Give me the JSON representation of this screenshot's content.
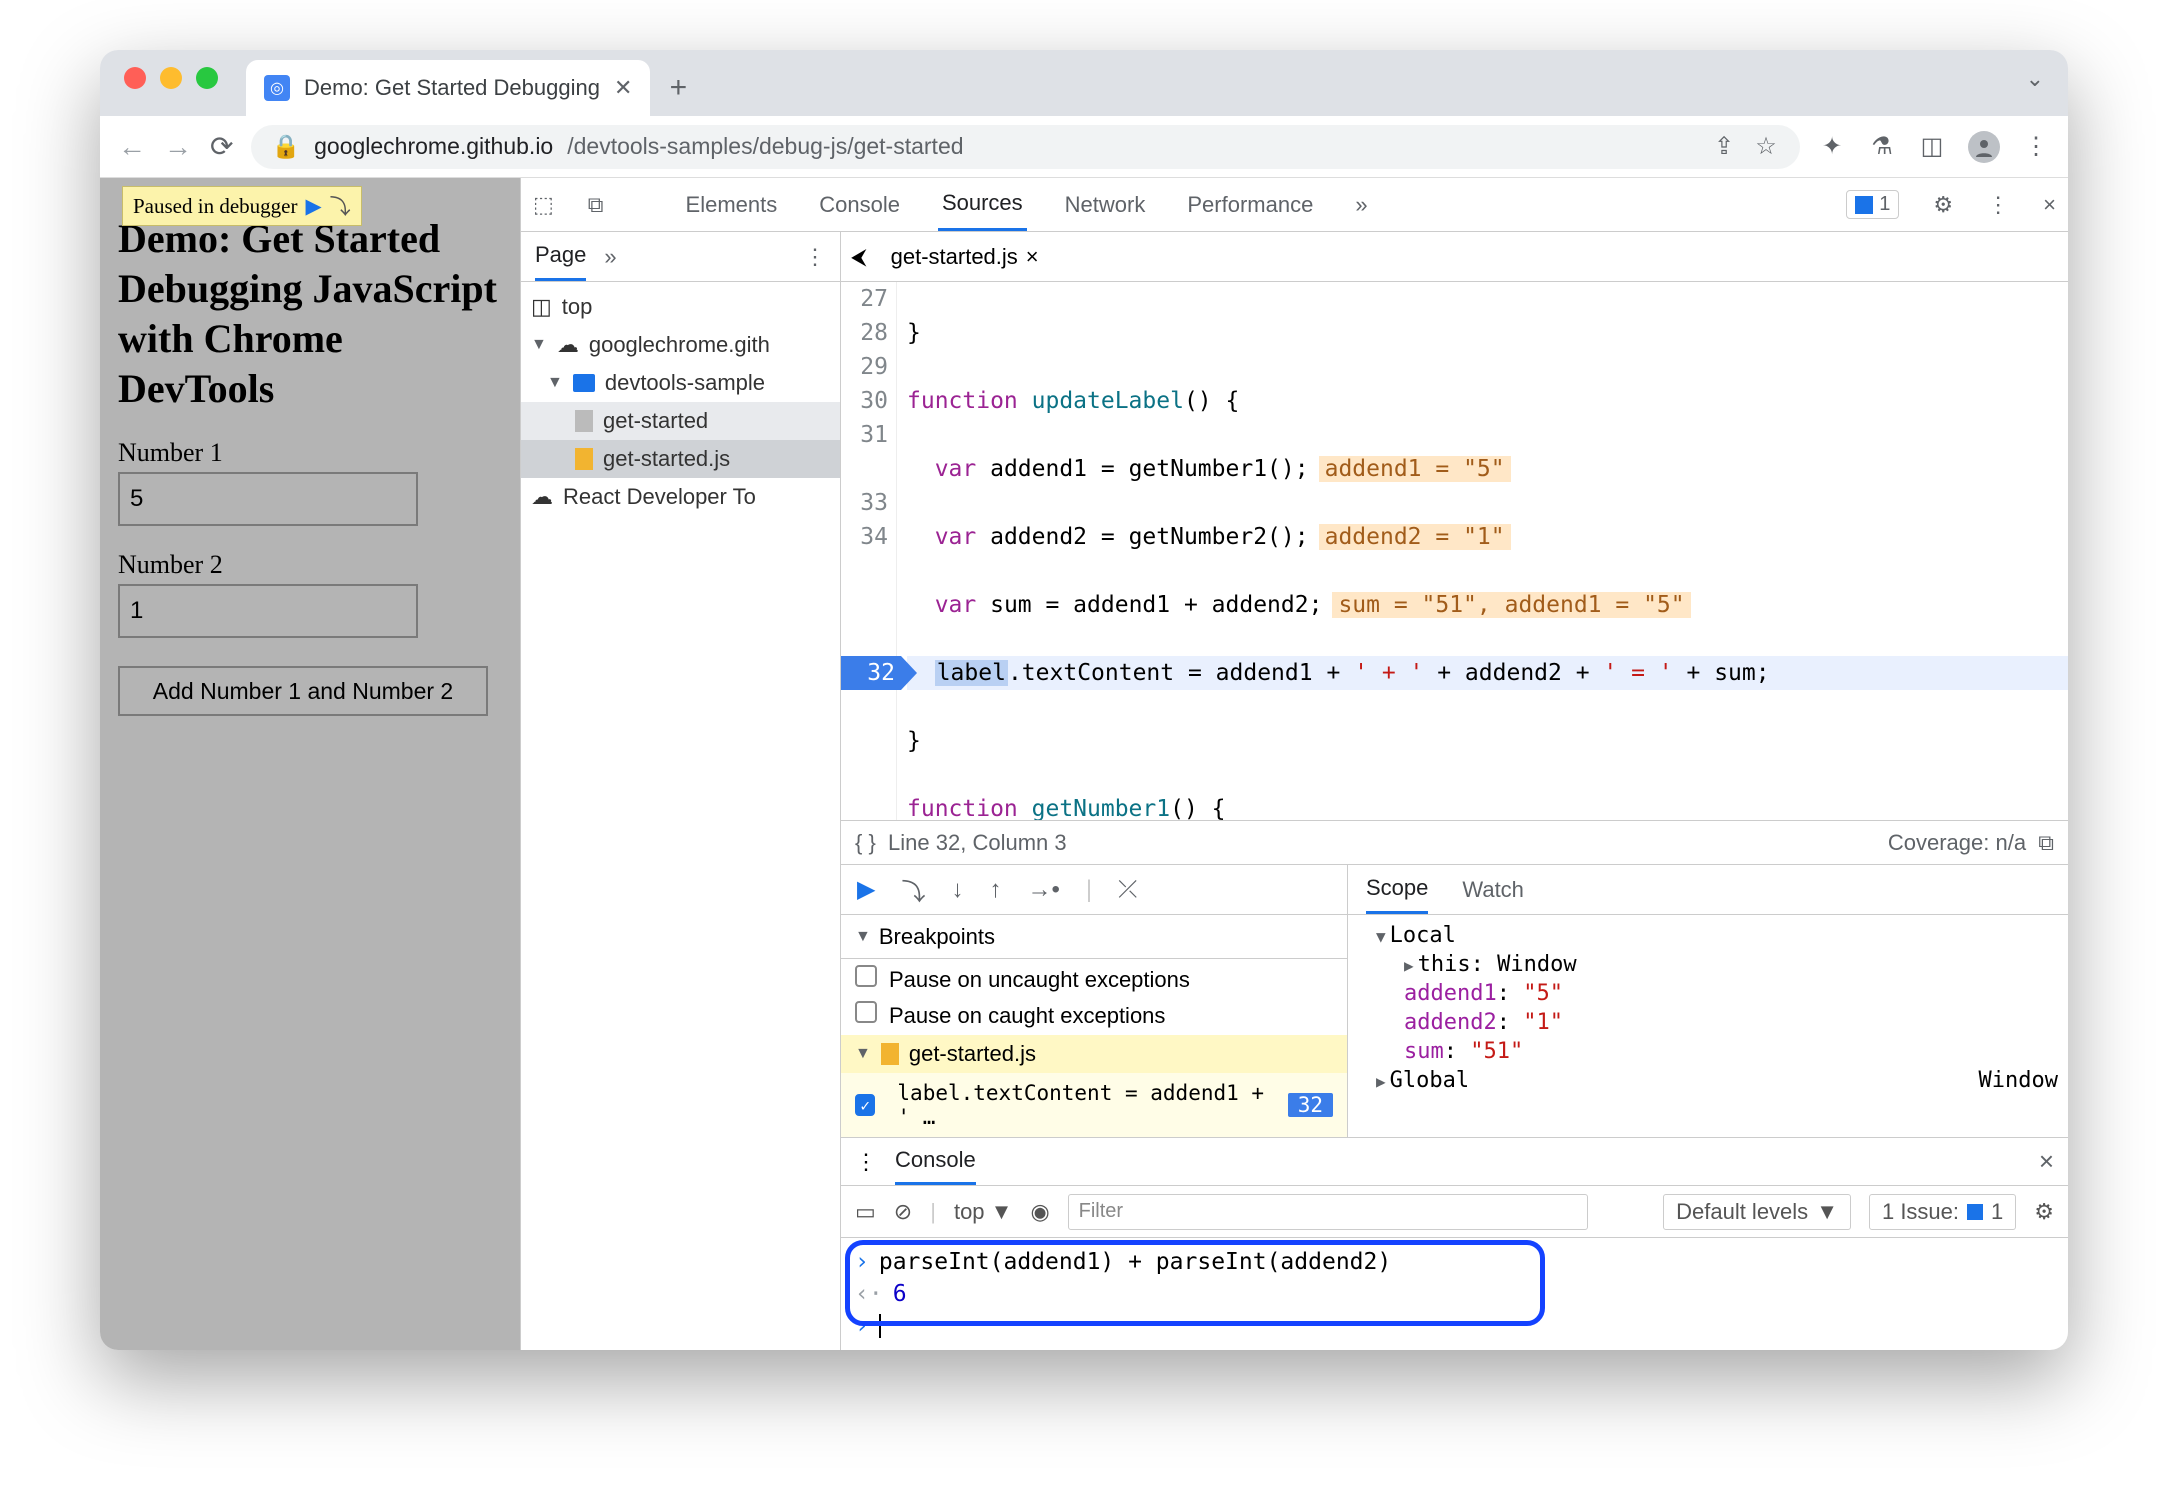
{
  "browser": {
    "tab_title": "Demo: Get Started Debugging",
    "url_host": "googlechrome.github.io",
    "url_path": "/devtools-samples/debug-js/get-started"
  },
  "page": {
    "paused_label": "Paused in debugger",
    "heading": "Demo: Get Started Debugging JavaScript with Chrome DevTools",
    "label1": "Number 1",
    "value1": "5",
    "label2": "Number 2",
    "value2": "1",
    "button": "Add Number 1 and Number 2"
  },
  "devtools": {
    "tabs": [
      "Elements",
      "Console",
      "Sources",
      "Network",
      "Performance"
    ],
    "active_tab": "Sources",
    "more": "»",
    "issues_count": "1",
    "close": "×"
  },
  "sources": {
    "nav_tab": "Page",
    "tree": {
      "top": "top",
      "host": "googlechrome.gith",
      "folder": "devtools-sample",
      "file_html": "get-started",
      "file_js": "get-started.js",
      "ext": "React Developer To"
    },
    "file_tab": "get-started.js",
    "lines": {
      "27": "}",
      "28_a": "function ",
      "28_b": "updateLabel",
      "28_c": "() {",
      "29_a": "  var addend1 = getNumber1();",
      "29_v": "addend1 = \"5\"",
      "30_a": "  var addend2 = getNumber2();",
      "30_v": "addend2 = \"1\"",
      "31_a": "  var sum = addend1 + addend2;",
      "31_v": "sum = \"51\", addend1 = \"5\"",
      "32_label": "label",
      "32_a": ".textContent = addend1 + ",
      "32_s1": "' + '",
      "32_b": " + addend2 + ",
      "32_s2": "' = '",
      "32_c": " + sum;",
      "33": "}",
      "34_a": "function ",
      "34_b": "getNumber1",
      "34_c": "() {"
    },
    "gutter": [
      "27",
      "28",
      "29",
      "30",
      "31",
      "32",
      "33",
      "34"
    ],
    "status_pos": "Line 32, Column 3",
    "coverage": "Coverage: n/a"
  },
  "debugger": {
    "breakpoints_title": "Breakpoints",
    "pause_uncaught": "Pause on uncaught exceptions",
    "pause_caught": "Pause on caught exceptions",
    "bp_file": "get-started.js",
    "bp_text": "label.textContent = addend1 + ' …",
    "bp_line": "32",
    "scope_tab": "Scope",
    "watch_tab": "Watch",
    "local": "Local",
    "this_lbl": "this",
    "this_val": "Window",
    "a1": "addend1",
    "a1v": "\"5\"",
    "a2": "addend2",
    "a2v": "\"1\"",
    "sum": "sum",
    "sumv": "\"51\"",
    "global": "Global",
    "global_v": "Window"
  },
  "console": {
    "title": "Console",
    "context": "top",
    "filter_placeholder": "Filter",
    "levels": "Default levels",
    "issues": "1 Issue:",
    "issues_n": "1",
    "input": "parseInt(addend1) + parseInt(addend2)",
    "result": "6"
  }
}
